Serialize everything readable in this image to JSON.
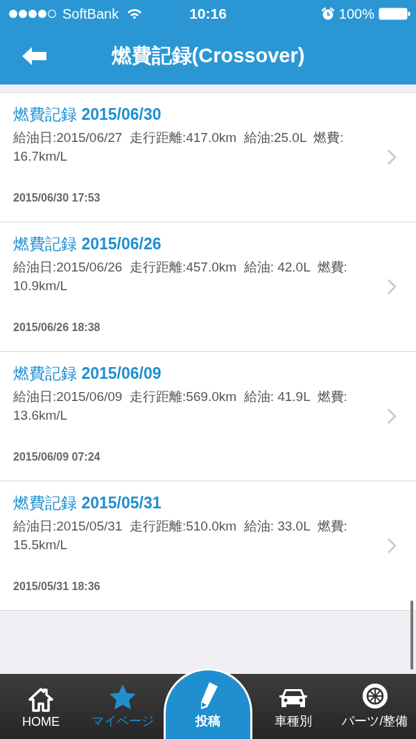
{
  "status_bar": {
    "carrier": "SoftBank",
    "time": "10:16",
    "battery": "100%"
  },
  "header": {
    "title": "燃費記録(Crossover)"
  },
  "records": [
    {
      "title": "燃費記録 **2015/06/30**",
      "detail": "給油日:2015/06/27  走行距離:417.0km  給油:25.0L  燃費: 16.7km/L",
      "timestamp": "2015/06/30 17:53"
    },
    {
      "title": "燃費記録 **2015/06/26**",
      "detail": "給油日:2015/06/26  走行距離:457.0km  給油: 42.0L  燃費: 10.9km/L",
      "timestamp": "2015/06/26 18:38"
    },
    {
      "title": "燃費記録 **2015/06/09**",
      "detail": "給油日:2015/06/09  走行距離:569.0km  給油: 41.9L  燃費: 13.6km/L",
      "timestamp": "2015/06/09 07:24"
    },
    {
      "title": "燃費記録 **2015/05/31**",
      "detail": "給油日:2015/05/31  走行距離:510.0km  給油: 33.0L  燃費: 15.5km/L",
      "timestamp": "2015/05/31 18:36"
    }
  ],
  "tab_bar": [
    {
      "label": "HOME",
      "selected": false,
      "kind": "normal"
    },
    {
      "label": "マイページ",
      "selected": true,
      "kind": "normal"
    },
    {
      "label": "投稿",
      "selected": false,
      "kind": "center"
    },
    {
      "label": "車種別",
      "selected": false,
      "kind": "normal"
    },
    {
      "label": "パーツ/整備",
      "selected": false,
      "kind": "normal"
    }
  ]
}
